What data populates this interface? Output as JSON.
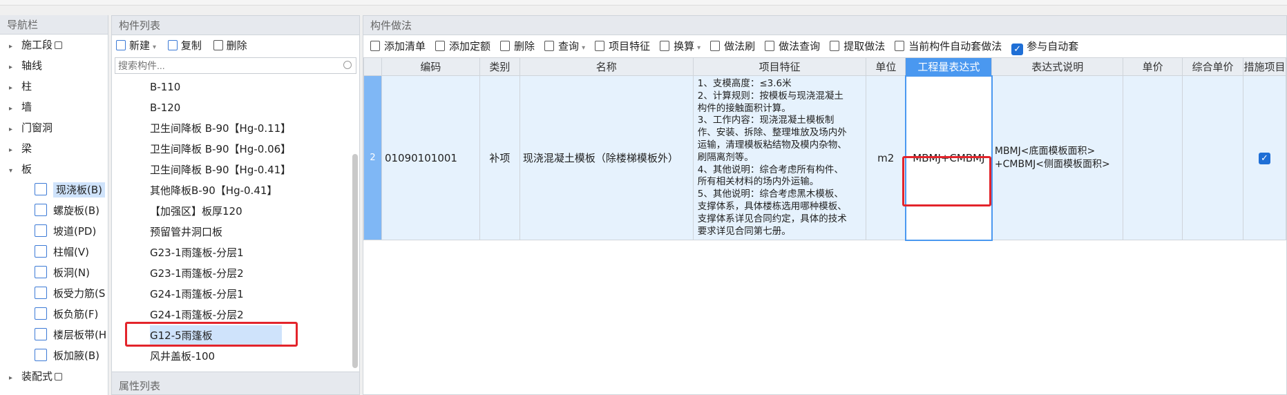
{
  "nav": {
    "title": "导航栏",
    "items_top": [
      {
        "label": "施工段",
        "lock": true
      },
      {
        "label": "轴线"
      },
      {
        "label": "柱"
      },
      {
        "label": "墙"
      },
      {
        "label": "门窗洞"
      },
      {
        "label": "梁"
      },
      {
        "label": "板",
        "expanded": true
      }
    ],
    "sub_items": [
      {
        "label": "现浇板(B)",
        "icon": "cast-slab-icon",
        "active": true
      },
      {
        "label": "螺旋板(B)",
        "icon": "spiral-slab-icon"
      },
      {
        "label": "坡道(PD)",
        "icon": "ramp-icon"
      },
      {
        "label": "柱帽(V)",
        "icon": "column-cap-icon"
      },
      {
        "label": "板洞(N)",
        "icon": "slab-hole-icon"
      },
      {
        "label": "板受力筋(S",
        "icon": "slab-rebar-icon"
      },
      {
        "label": "板负筋(F)",
        "icon": "negative-rebar-icon"
      },
      {
        "label": "楼层板带(H",
        "icon": "floor-band-icon"
      },
      {
        "label": "板加腋(B)",
        "icon": "slab-haunch-icon"
      }
    ],
    "items_bottom": [
      {
        "label": "装配式",
        "lock": true
      }
    ]
  },
  "complist": {
    "title": "构件列表",
    "new_label": "新建",
    "copy_label": "复制",
    "delete_label": "删除",
    "search_placeholder": "搜索构件...",
    "items": [
      "B-110",
      "B-120",
      "卫生间降板 B-90【Hg-0.11】",
      "卫生间降板 B-90【Hg-0.06】",
      "卫生间降板 B-90【Hg-0.41】",
      "其他降板B-90【Hg-0.41】",
      "【加强区】板厚120",
      "预留管井洞口板",
      "G23-1雨篷板-分层1",
      "G23-1雨篷板-分层2",
      "G24-1雨篷板-分层1",
      "G24-1雨篷板-分层2",
      "G12-5雨篷板",
      "风井盖板-100"
    ],
    "selected_index": 12
  },
  "proplist": {
    "title": "属性列表"
  },
  "methods": {
    "title": "构件做法",
    "toolbar": [
      {
        "label": "添加清单",
        "icon": "add-list-icon"
      },
      {
        "label": "添加定额",
        "icon": "add-quota-icon"
      },
      {
        "label": "删除",
        "icon": "delete-icon"
      },
      {
        "label": "查询",
        "icon": "query-icon",
        "dropdown": true
      },
      {
        "label": "项目特征",
        "icon": "project-feature-icon"
      },
      {
        "label": "换算",
        "icon": "formula-icon",
        "dropdown": true
      },
      {
        "label": "做法刷",
        "icon": "method-brush-icon"
      },
      {
        "label": "做法查询",
        "icon": "method-query-icon"
      },
      {
        "label": "提取做法",
        "icon": "extract-method-icon"
      },
      {
        "label": "当前构件自动套做法",
        "icon": "auto-apply-icon"
      },
      {
        "label": "参与自动套",
        "icon": "checkbox-checked-icon",
        "checked": true
      }
    ],
    "columns": [
      "编码",
      "类别",
      "名称",
      "项目特征",
      "单位",
      "工程量表达式",
      "表达式说明",
      "单价",
      "综合单价",
      "措施项目"
    ],
    "rows": [
      {
        "row_no": "2",
        "code": "01090101001",
        "category": "补项",
        "name": "现浇混凝土模板（除楼梯模板外）",
        "features": [
          "1、支模高度：≤3.6米",
          "2、计算规则：按模板与现浇混凝土",
          "构件的接触面积计算。",
          "3、工作内容：现浇混凝土模板制",
          "作、安装、拆除、整理堆放及场内外",
          "运输，清理模板粘结物及模内杂物、",
          "刷隔离剂等。",
          "4、其他说明：综合考虑所有构件、",
          "所有相关材料的场内外运输。",
          "5、其他说明：综合考虑黑木模板、",
          "支撑体系，具体楼栋选用哪种模板、",
          "支撑体系详见合同约定，具体的技术",
          "要求详见合同第七册。"
        ],
        "unit": "m2",
        "expression": "MBMJ+CMBMJ",
        "expression_desc_1": "MBMJ<底面模板面积>",
        "expression_desc_2": "+CMBMJ<侧面模板面积>",
        "unit_price": "",
        "composite_price": "",
        "measure_checked": true
      }
    ]
  },
  "colors": {
    "accent": "#4a98f0",
    "highlight_bg": "#cfe3fb",
    "annotation_red": "#e3242b",
    "row_bg": "#e6f2fd"
  }
}
